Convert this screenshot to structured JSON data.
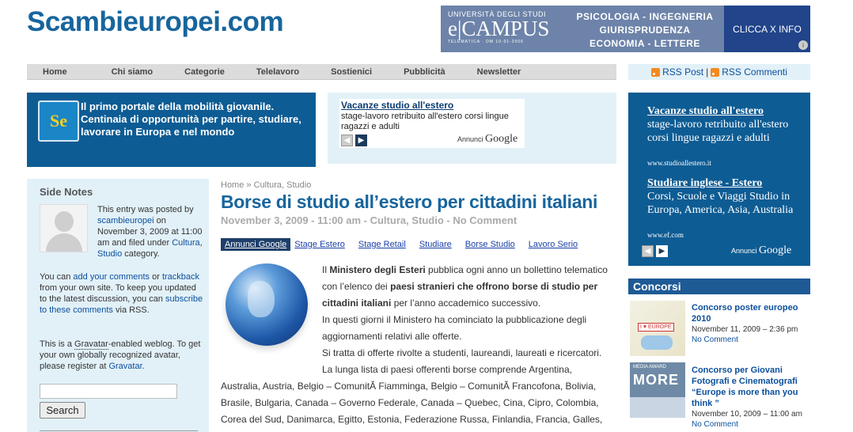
{
  "site": {
    "logo": "Scambieuropei.com"
  },
  "banner": {
    "uni": "UNIVERSITÀ DEGLI STUDI",
    "brand": "e|CAMPUS",
    "telematica": "TELEMATICA · DM 10-01-2006",
    "fac1": "PSICOLOGIA - INGEGNERIA",
    "fac2": "GIURISPRUDENZA",
    "fac3": "ECONOMIA - LETTERE",
    "cta": "CLICCA X INFO",
    "info": "i"
  },
  "nav": {
    "items": [
      "Home",
      "Chi siamo",
      "Categorie",
      "Telelavoro",
      "Sostienici",
      "Pubblicità",
      "Newsletter"
    ]
  },
  "rss": {
    "post": "RSS Post",
    "sep": "|",
    "comments": "RSS Commenti"
  },
  "intro": {
    "logo_text": "Se",
    "text": "Il primo portale della mobilità giovanile. Centinaia di opportunità per partire, studiare, lavorare in Europa e nel mondo"
  },
  "ad_top": {
    "title": "Vacanze studio all'estero",
    "desc": "stage-lavoro retribuito all'estero corsi lingue ragazzi e adulti",
    "label": "Annunci",
    "google": "Google"
  },
  "ad_right": {
    "ads": [
      {
        "title": "Vacanze studio all'estero",
        "desc": "stage-lavoro retribuito all'estero corsi lingue ragazzi e adulti",
        "url": "www.studioallestero.it"
      },
      {
        "title": "Studiare inglese - Estero",
        "desc": "Corsi, Scuole e Viaggi Studio in Europa, America, Asia, Australia",
        "url": "www.ef.com"
      }
    ],
    "label": "Annunci",
    "google": "Google"
  },
  "side": {
    "heading": "Side Notes",
    "posted_a": "This entry was posted by",
    "author": "scambieuropei",
    "posted_b": "on November 3, 2009 at 11:00 am and filed under",
    "cat1": "Cultura",
    "comma": ",",
    "cat2": "Studio",
    "category": "category.",
    "can": "You can",
    "add": "add your comments",
    "or": "or",
    "trackback": "trackback",
    "keep": "from your own site. To keep you updated to the latest discussion, you can",
    "subscribe": "subscribe to these comments",
    "via": "via RSS.",
    "grav_a": "This is a",
    "gravatar": "Gravatar",
    "grav_b": "-enabled weblog. To get your own globally recognized avatar, please register at",
    "gravatar2": "Gravatar",
    "dot": ".",
    "search_btn": "Search"
  },
  "post": {
    "crumb_home": "Home",
    "crumb_sep": "»",
    "crumb_cat": "Cultura, Studio",
    "title": "Borse di studio all’estero per cittadini italiani",
    "meta": "November 3, 2009 - 11:00 am - Cultura, Studio - No Comment",
    "adlinks_label": "Annunci Google",
    "adlinks": [
      "Stage Estero",
      "Stage Retail",
      "Studiare",
      "Borse Studio",
      "Lavoro Serio"
    ],
    "l1a": "Il ",
    "l1b": "Ministero degli Esteri",
    "l1c": " pubblica ogni anno un bollettino telematico",
    "l2a": "con l’elenco dei ",
    "l2b": "paesi stranieri che offrono borse di studio per",
    "l3a": "cittadini italiani",
    "l3b": " per l’anno accademico successivo.",
    "l4": "In questi giorni il Ministero ha cominciato la pubblicazione degli",
    "l5": "aggiornamenti relativi alle offerte.",
    "l6": "Si tratta di offerte rivolte a studenti, laureandi, laureati e ricercatori.",
    "l7": "La lunga lista di paesi offerenti borse comprende Argentina,",
    "l8": "Australia, Austria, Belgio – ComunitĂ Fiamminga, Belgio – ComunitĂ Francofona, Bolivia,",
    "l9": "Brasile, Bulgaria, Canada – Governo Federale, Canada – Quebec, Cina, Cipro, Colombia,",
    "l10": "Corea del Sud, Danimarca, Egitto, Estonia, Federazione Russa, Finlandia, Francia, Galles,"
  },
  "concorsi": {
    "heading": "Concorsi",
    "items": [
      {
        "title": "Concorso poster europeo 2010",
        "date": "November 11, 2009 – 2:36 pm",
        "comments": "No Comment",
        "thumb": "I ♥ EUROPE"
      },
      {
        "title": "Concorso per Giovani Fotografi e Cinematografi “Europe is more than you think ”",
        "date": "November 10, 2009 – 11:00 am",
        "comments": "No Comment",
        "thumb_a": "MEDIA AWARD",
        "thumb_b": "MORE"
      }
    ]
  }
}
